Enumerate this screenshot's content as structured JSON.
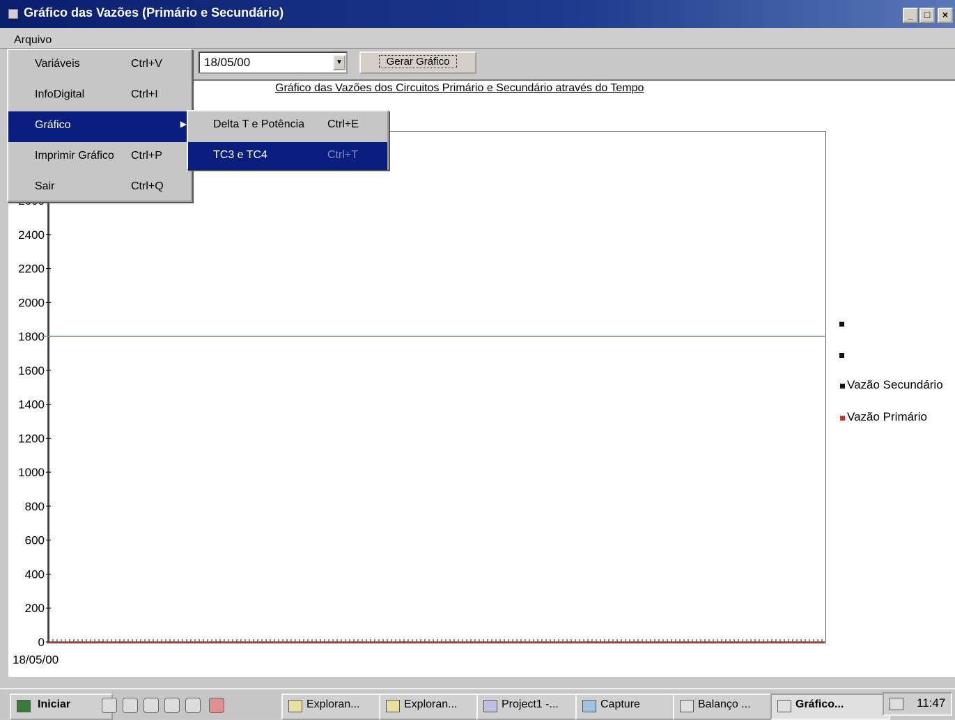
{
  "window": {
    "title": "Gráfico das Vazões (Primário e Secundário)",
    "controls": [
      "_",
      "□",
      "×"
    ]
  },
  "menubar": {
    "arquivo": "Arquivo"
  },
  "file_menu": [
    {
      "label": "Variáveis",
      "shortcut": "Ctrl+V",
      "selected": false
    },
    {
      "label": "InfoDigital",
      "shortcut": "Ctrl+I",
      "selected": false
    },
    {
      "label": "Gráfico",
      "shortcut": "",
      "selected": true,
      "submenu": true
    },
    {
      "label": "Imprimir Gráfico",
      "shortcut": "Ctrl+P",
      "selected": false
    },
    {
      "label": "Sair",
      "shortcut": "Ctrl+Q",
      "selected": false
    }
  ],
  "submenu": [
    {
      "label": "Delta T e Potência",
      "shortcut": "Ctrl+E",
      "selected": false
    },
    {
      "label": "TC3 e TC4",
      "shortcut": "Ctrl+T",
      "selected": true
    }
  ],
  "toolbar": {
    "date_value": "18/05/00",
    "generate_label": "Gerar Gráfico"
  },
  "chart_data": {
    "type": "line",
    "title": "Gráfico das Vazões dos Circuitos Primário e Secundário através do Tempo",
    "x_tick_labels": [
      "18/05/00"
    ],
    "y_ticks": [
      0,
      200,
      400,
      600,
      800,
      1000,
      1200,
      1400,
      1600,
      1800,
      2000,
      2200,
      2400,
      2600
    ],
    "ylim": [
      0,
      2600
    ],
    "series": [
      {
        "name": "Vazão Secundário",
        "color": "#6aa86a",
        "values": [
          1800,
          1800
        ]
      },
      {
        "name": "Vazão Primário",
        "color": "#cc3333",
        "values": [
          0,
          0
        ]
      }
    ],
    "legend": [
      "Vazão Secundário",
      "Vazão Primário"
    ],
    "legend_position": "right",
    "grid": false
  },
  "taskbar": {
    "start_label": "Iniciar",
    "buttons": [
      {
        "label": "Exploran...",
        "active": false
      },
      {
        "label": "Exploran...",
        "active": false
      },
      {
        "label": "Project1 -...",
        "active": false
      },
      {
        "label": "Capture",
        "active": false
      },
      {
        "label": "Balanço ...",
        "active": false
      },
      {
        "label": "Gráfico...",
        "active": true
      }
    ],
    "clock": "11:47"
  }
}
